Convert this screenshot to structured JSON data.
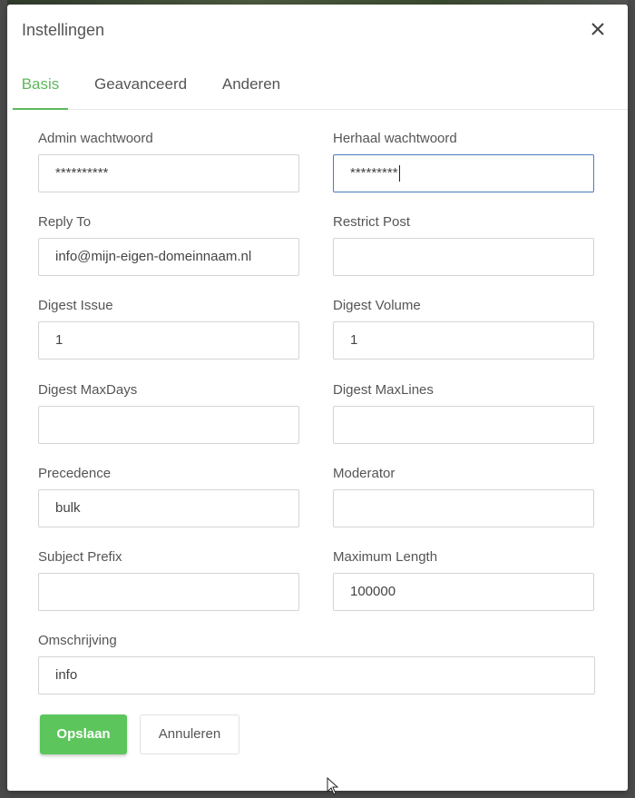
{
  "modal": {
    "title": "Instellingen",
    "close_icon": "close-icon"
  },
  "tabs": [
    {
      "label": "Basis",
      "active": true
    },
    {
      "label": "Geavanceerd",
      "active": false
    },
    {
      "label": "Anderen",
      "active": false
    }
  ],
  "form": {
    "admin_password": {
      "label": "Admin wachtwoord",
      "value": "**********"
    },
    "repeat_password": {
      "label": "Herhaal wachtwoord",
      "value": "*********"
    },
    "reply_to": {
      "label": "Reply To",
      "value": "info@mijn-eigen-domeinnaam.nl"
    },
    "restrict_post": {
      "label": "Restrict Post",
      "value": ""
    },
    "digest_issue": {
      "label": "Digest Issue",
      "value": "1"
    },
    "digest_volume": {
      "label": "Digest Volume",
      "value": "1"
    },
    "digest_maxdays": {
      "label": "Digest MaxDays",
      "value": ""
    },
    "digest_maxlines": {
      "label": "Digest MaxLines",
      "value": ""
    },
    "precedence": {
      "label": "Precedence",
      "value": "bulk"
    },
    "moderator": {
      "label": "Moderator",
      "value": ""
    },
    "subject_prefix": {
      "label": "Subject Prefix",
      "value": ""
    },
    "maximum_length": {
      "label": "Maximum Length",
      "value": "100000"
    },
    "description": {
      "label": "Omschrijving",
      "value": "info"
    }
  },
  "buttons": {
    "save": "Opslaan",
    "cancel": "Annuleren"
  },
  "colors": {
    "accent": "#5cb85c",
    "save_button": "#5cc65c",
    "focus_border": "#4a7bbf"
  }
}
